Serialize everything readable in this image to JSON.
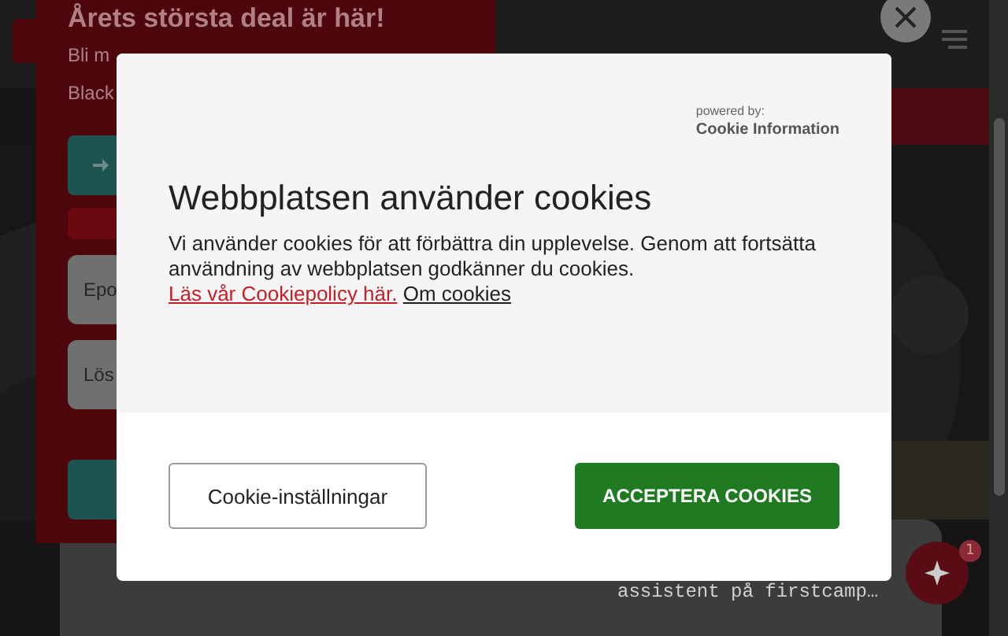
{
  "background": {
    "promo_title": "Årets största deal är här!",
    "promo_text": [
      "Bli m",
      "Black"
    ],
    "fields": [
      {
        "placeholder": "Epo"
      },
      {
        "placeholder": "Lös"
      }
    ],
    "chat_snippet": "assistent på firstcamp…",
    "chat_badge": "1"
  },
  "cookie_dialog": {
    "powered_by": "powered by:",
    "provider": "Cookie Information",
    "title": "Webbplatsen använder cookies",
    "text": "Vi använder cookies för att förbättra din upplevelse. Genom att fortsätta användning av webbplatsen godkänner du cookies.",
    "links": [
      {
        "label": "Läs vår Cookiepolicy här.",
        "kind": "policy"
      },
      {
        "label": "Om cookies",
        "kind": "about"
      }
    ],
    "buttons": [
      {
        "label": "Cookie-inställningar",
        "kind": "secondary"
      },
      {
        "label": "ACCEPTERA COOKIES",
        "kind": "primary"
      }
    ]
  }
}
